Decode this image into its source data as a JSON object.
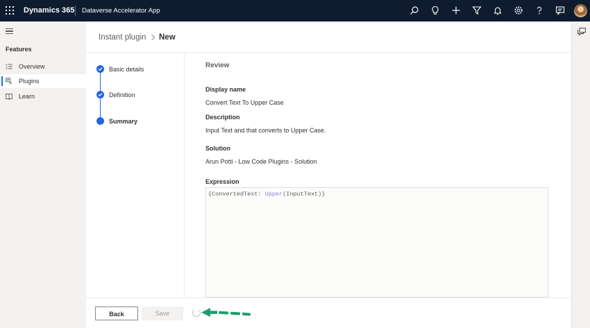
{
  "topbar": {
    "brand": "Dynamics 365",
    "app_name": "Dataverse Accelerator App",
    "icons": [
      "search-icon",
      "lightbulb-icon",
      "add-icon",
      "filter-icon",
      "bell-icon",
      "gear-icon",
      "help-icon",
      "chat-icon",
      "avatar"
    ]
  },
  "sidebar": {
    "section_title": "Features",
    "items": [
      {
        "label": "Overview",
        "icon": "overview-icon",
        "active": false
      },
      {
        "label": "Plugins",
        "icon": "plugins-icon",
        "active": true
      },
      {
        "label": "Learn",
        "icon": "book-icon",
        "active": false
      }
    ]
  },
  "breadcrumb": {
    "parent": "Instant plugin",
    "separator": ">",
    "current": "New"
  },
  "steps": [
    {
      "label": "Basic details",
      "state": "completed"
    },
    {
      "label": "Definition",
      "state": "completed"
    },
    {
      "label": "Summary",
      "state": "current"
    }
  ],
  "review": {
    "title": "Review",
    "display_name_label": "Display name",
    "display_name_value": "Convert Text To Upper Case",
    "description_label": "Description",
    "description_value": "Input Text and that converts to Upper Case.",
    "solution_label": "Solution",
    "solution_value": "Arun Potti - Low Code Plugins - Solution",
    "expression_label": "Expression",
    "expression_prefix": "{ConvertedText: ",
    "expression_fn": "Upper",
    "expression_suffix": "(InputText)}"
  },
  "footer": {
    "back_label": "Back",
    "save_label": "Save"
  },
  "colors": {
    "topbar": "#0f1c30",
    "accent": "#2266e3",
    "arrow": "#1e9e6a"
  }
}
